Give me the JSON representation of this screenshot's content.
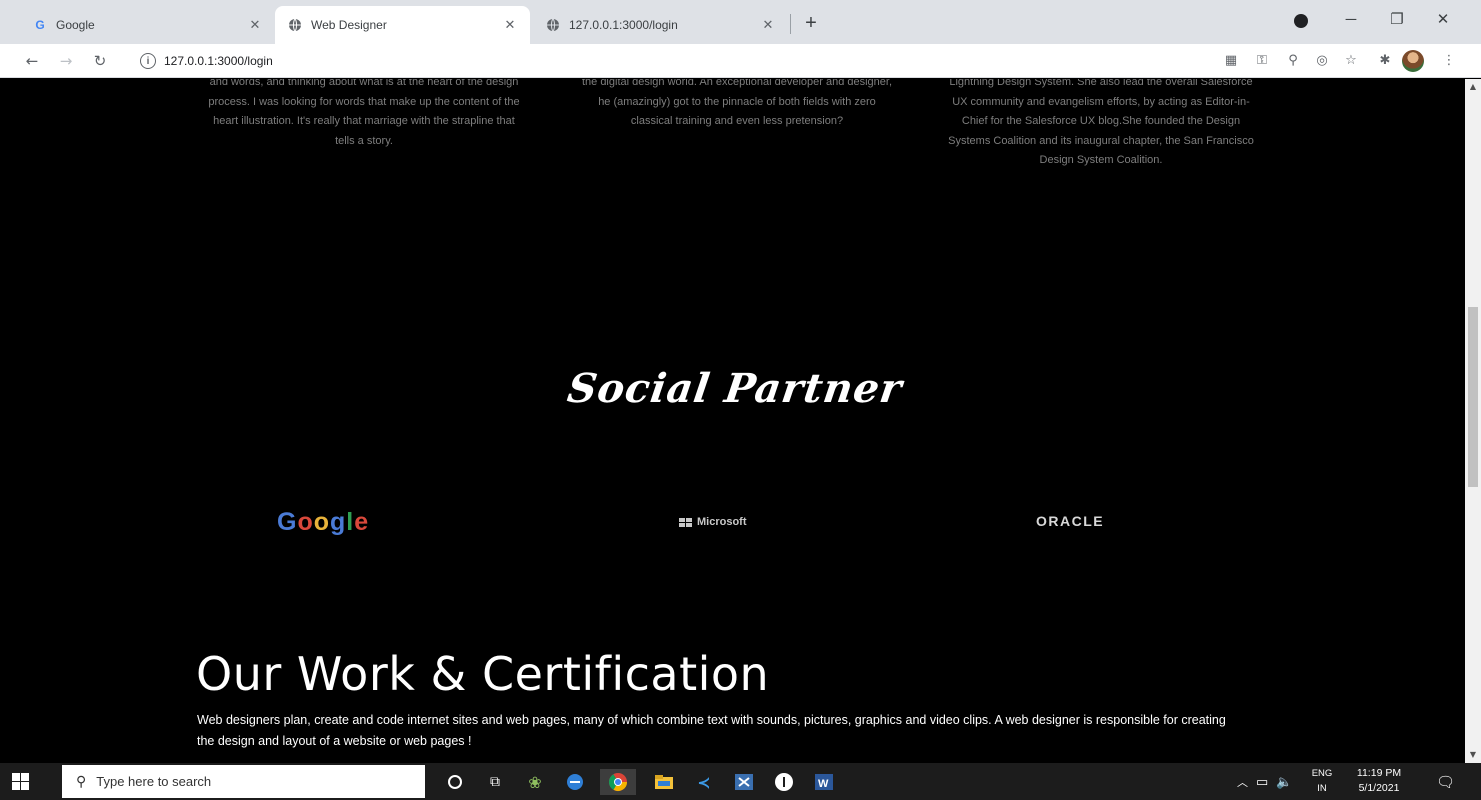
{
  "browser": {
    "tabs": [
      {
        "title": "Google",
        "favicon": "google-g-icon",
        "active": false
      },
      {
        "title": "Web Designer",
        "favicon": "globe-icon",
        "active": true
      },
      {
        "title": "127.0.0.1:3000/login",
        "favicon": "globe-icon",
        "active": false
      }
    ],
    "url": "127.0.0.1:3000/login"
  },
  "page": {
    "bios": [
      "and words, and thinking about what is at the heart of the design process. I was looking for words that make up the content of the heart illustration. It's really that marriage with the strapline that tells a story.",
      "the digital design world. An exceptional developer and designer, he (amazingly) got to the pinnacle of both fields with zero classical training and even less pretension?",
      "Lightning Design System. She also lead the overall Salesforce UX community and evangelism efforts, by acting as Editor-in-Chief for the Salesforce UX blog.She founded the Design Systems Coalition and its inaugural chapter, the San Francisco Design System Coalition."
    ],
    "social_title": "Social Partner",
    "partners": {
      "google": "Google",
      "microsoft": "Microsoft",
      "oracle": "ORACLE"
    },
    "work_title": "Our Work & Certification",
    "work_description": "Web designers plan, create and code internet sites and web pages, many of which combine text with sounds, pictures, graphics and video clips. A web designer is responsible for creating the design and layout of a website or web pages !"
  },
  "taskbar": {
    "search_placeholder": "Type here to search",
    "lang_top": "ENG",
    "lang_bottom": "IN",
    "time": "11:19 PM",
    "date": "5/1/2021"
  }
}
